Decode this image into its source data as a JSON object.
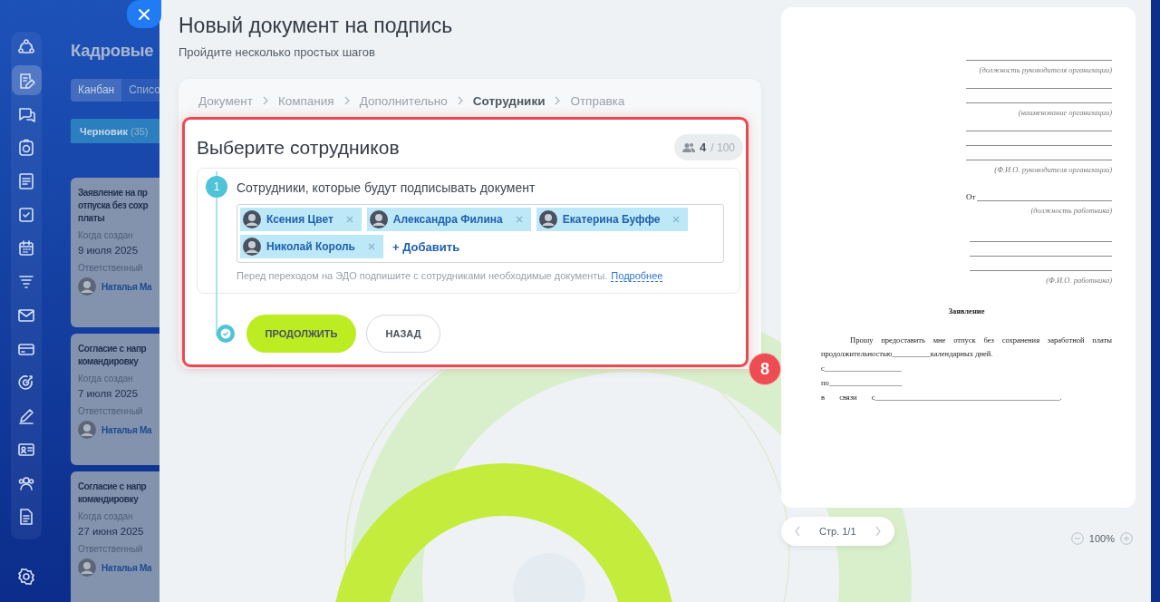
{
  "sidebar": {
    "items": [
      {
        "selected": false
      },
      {
        "selected": true
      },
      {
        "selected": false
      },
      {
        "selected": false
      },
      {
        "selected": false
      },
      {
        "selected": false
      },
      {
        "selected": false
      },
      {
        "selected": false
      },
      {
        "selected": false
      },
      {
        "selected": false
      },
      {
        "selected": false
      },
      {
        "selected": false
      },
      {
        "selected": false
      },
      {
        "selected": false
      },
      {
        "selected": false
      }
    ]
  },
  "background_page": {
    "title": "Кадровые",
    "tabs": [
      {
        "label": "Канбан",
        "selected": true
      },
      {
        "label": "Списо",
        "selected": false
      }
    ],
    "column": {
      "name": "Черновик",
      "count": "(35)"
    },
    "cards": [
      {
        "title_lines": [
          "Заявление на пр",
          "отпуска без сохр",
          "платы"
        ],
        "created_label": "Когда создан",
        "created": "9 июля 2025",
        "responsible_label": "Ответственный",
        "person": "Наталья Ма"
      },
      {
        "title_lines": [
          "Согласие с напр",
          "командировку"
        ],
        "created_label": "Когда создан",
        "created": "7 июля 2025",
        "responsible_label": "Ответственный",
        "person": "Наталья Ма"
      },
      {
        "title_lines": [
          "Согласие с напр",
          "командировку"
        ],
        "created_label": "Когда создан",
        "created": "27 июня 2025",
        "responsible_label": "Ответственный",
        "person": "Наталья Ма"
      }
    ]
  },
  "panel": {
    "title": "Новый документ на подпись",
    "subtitle": "Пройдите несколько простых шагов",
    "steps": [
      {
        "label": "Документ",
        "selected": false
      },
      {
        "label": "Компания",
        "selected": false
      },
      {
        "label": "Дополнительно",
        "selected": false
      },
      {
        "label": "Сотрудники",
        "selected": true
      },
      {
        "label": "Отправка",
        "selected": false
      }
    ],
    "section_title": "Выберите сотрудников",
    "counter": {
      "count": "4",
      "limit": "/ 100"
    },
    "step": {
      "number": "1",
      "label": "Сотрудники, которые будут подписывать документ",
      "employees": [
        "Ксения Цвет",
        "Александра Филина",
        "Екатерина Буффе",
        "Николай Король"
      ],
      "add_label": "+ Добавить",
      "hint": "Перед переходом на ЭДО подпишите с сотрудниками необходимые документы.",
      "hint_link": "Подробнее"
    },
    "buttons": {
      "continue": "ПРОДОЛЖИТЬ",
      "back": "НАЗАД"
    },
    "annotation_badge": "8"
  },
  "preview": {
    "header": [
      {
        "kind": "rule"
      },
      {
        "kind": "caption",
        "text": "(должность руководителя организации)"
      },
      {
        "kind": "rule"
      },
      {
        "kind": "rule"
      },
      {
        "kind": "caption",
        "text": "(наименование организации)"
      },
      {
        "kind": "rule"
      },
      {
        "kind": "rule"
      },
      {
        "kind": "rule"
      },
      {
        "kind": "caption",
        "text": "(Ф.И.О. руководителя организации)"
      },
      {
        "kind": "from",
        "text": "От"
      },
      {
        "kind": "caption",
        "text": "(должность работника)"
      },
      {
        "kind": "rule"
      },
      {
        "kind": "rule"
      },
      {
        "kind": "rule"
      },
      {
        "kind": "caption",
        "text": "(Ф.И.О. работника)"
      }
    ],
    "heading": "Заявление",
    "paragraph": "Прошу предоставить мне отпуск без сохранения заработной платы продолжительностью__________календарных дней.",
    "lines": [
      "с____________________",
      "по___________________",
      "в связи с________________________________________________."
    ],
    "page": "Стр. 1/1",
    "zoom": "100%"
  }
}
